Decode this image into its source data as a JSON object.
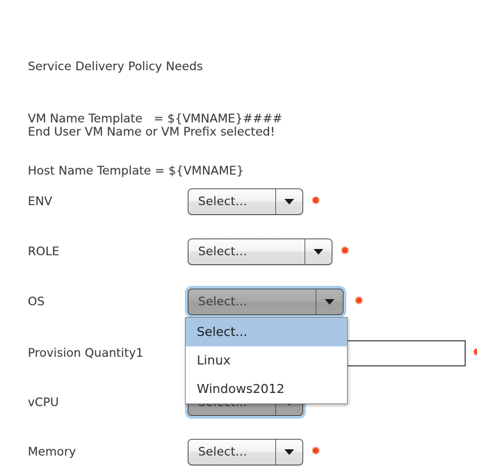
{
  "header": {
    "title": "Service Delivery Policy Needs",
    "lines": [
      {
        "label": "VM Name Template",
        "separator": "=",
        "value": "${VMNAME}####"
      },
      {
        "label": "Host Name Template",
        "separator": "=",
        "value": "${VMNAME}"
      }
    ],
    "vm_name_line": "VM Name Template   = ${VMNAME}####",
    "host_name_line": "Host Name Template = ${VMNAME}"
  },
  "notice": "End User VM Name or VM Prefix selected!",
  "colors": {
    "required_asterisk": "#f0481c",
    "menu_highlight": "#a8c6e5",
    "focus_ring": "#a9cdec",
    "text": "#333333"
  },
  "required_marker": "✹",
  "form": {
    "fields": [
      {
        "name": "env",
        "label": "ENV",
        "control": "dropdown",
        "value": "Select...",
        "required": true,
        "state": "closed"
      },
      {
        "name": "role",
        "label": "ROLE",
        "control": "dropdown",
        "value": "Select...",
        "required": true,
        "state": "closed"
      },
      {
        "name": "os",
        "label": "OS",
        "control": "dropdown",
        "value": "Select...",
        "required": true,
        "state": "open",
        "options": [
          "Select...",
          "Linux",
          "Windows2012"
        ],
        "selected_option": "Select..."
      },
      {
        "name": "provision-quantity1",
        "label": "Provision Quantity1",
        "control": "text",
        "value": "",
        "placeholder": "",
        "required": true
      },
      {
        "name": "vcpu",
        "label": "vCPU",
        "control": "dropdown",
        "value": "Select...",
        "required": true,
        "state": "closed"
      },
      {
        "name": "memory",
        "label": "Memory",
        "control": "dropdown",
        "value": "Select...",
        "required": true,
        "state": "closed"
      }
    ]
  },
  "dropdown_menu": {
    "items": [
      {
        "label": "Select...",
        "selected": true
      },
      {
        "label": "Linux",
        "selected": false
      },
      {
        "label": "Windows2012",
        "selected": false
      }
    ]
  },
  "icons": {
    "chevron_down": "chevron-down-icon"
  }
}
